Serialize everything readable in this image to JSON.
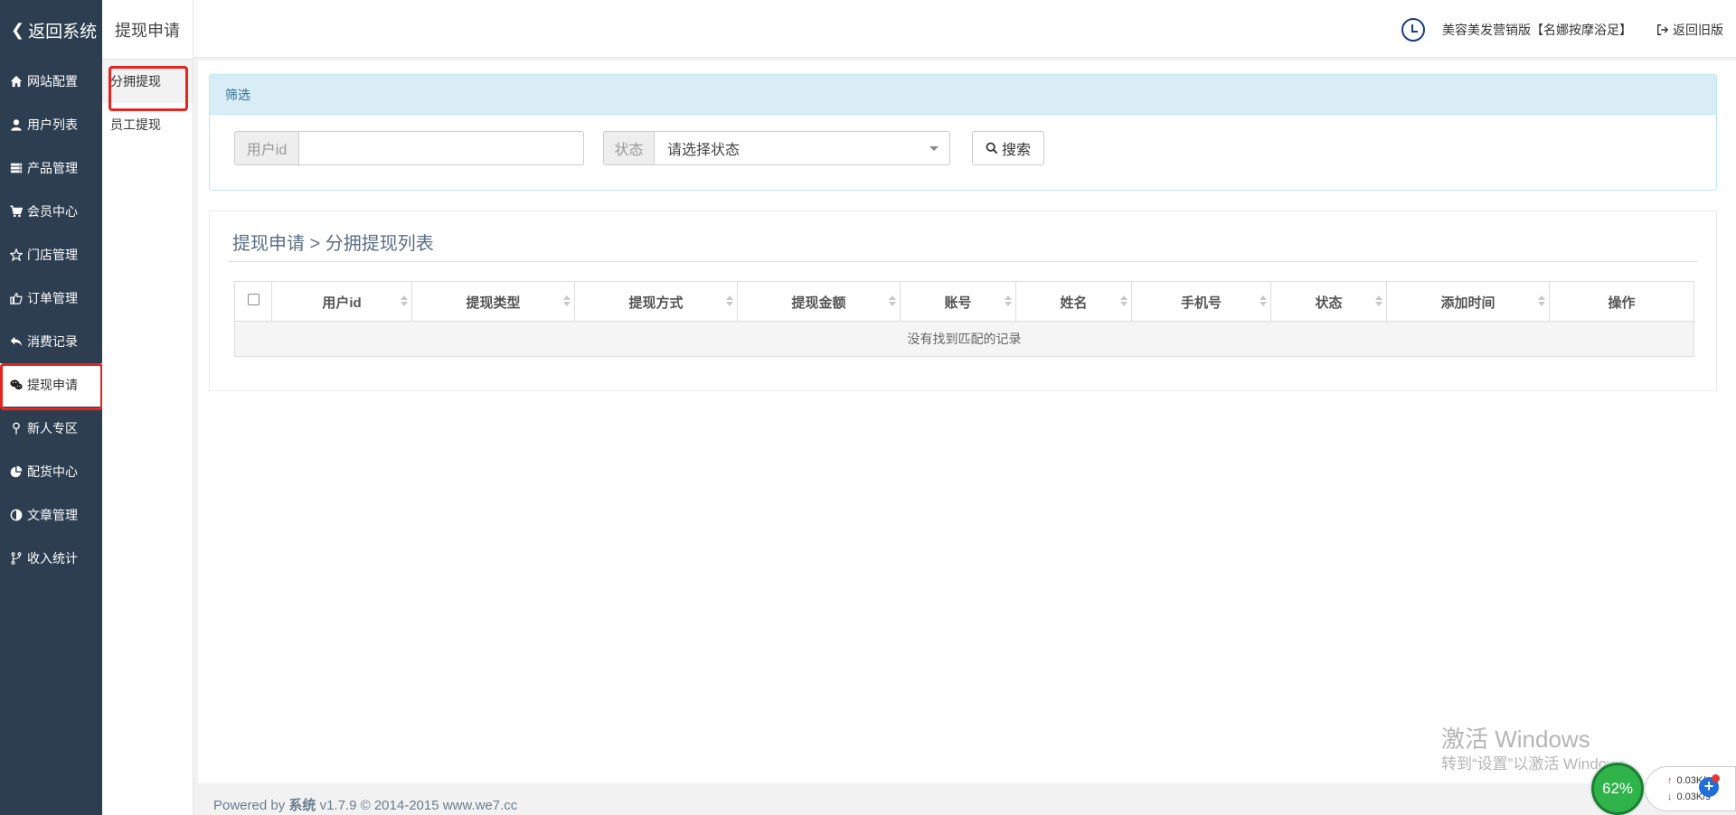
{
  "sidebar": {
    "back_label": "返回系统",
    "items": [
      {
        "label": "网站配置",
        "icon": "home-icon"
      },
      {
        "label": "用户列表",
        "icon": "user-icon"
      },
      {
        "label": "产品管理",
        "icon": "server-icon"
      },
      {
        "label": "会员中心",
        "icon": "cart-icon"
      },
      {
        "label": "门店管理",
        "icon": "star-icon"
      },
      {
        "label": "订单管理",
        "icon": "thumbs-up-icon"
      },
      {
        "label": "消费记录",
        "icon": "reply-icon"
      },
      {
        "label": "提现申请",
        "icon": "wechat-icon",
        "active": true
      },
      {
        "label": "新人专区",
        "icon": "map-pin-icon"
      },
      {
        "label": "配货中心",
        "icon": "pie-chart-icon"
      },
      {
        "label": "文章管理",
        "icon": "adjust-icon"
      },
      {
        "label": "收入统计",
        "icon": "code-fork-icon"
      }
    ]
  },
  "submenu": {
    "title": "提现申请",
    "items": [
      {
        "label": "分拥提现",
        "active": true
      },
      {
        "label": "员工提现"
      }
    ]
  },
  "header": {
    "brand": "美容美发营销版【名娜按摩浴足】",
    "back_old": "返回旧版"
  },
  "filter": {
    "heading": "筛选",
    "user_id_label": "用户id",
    "user_id_value": "",
    "status_label": "状态",
    "status_selected": "请选择状态",
    "search_label": "搜索"
  },
  "list": {
    "title": "提现申请 > 分拥提现列表",
    "columns": [
      "用户id",
      "提现类型",
      "提现方式",
      "提现金额",
      "账号",
      "姓名",
      "手机号",
      "状态",
      "添加时间",
      "操作"
    ],
    "empty_text": "没有找到匹配的记录"
  },
  "footer": {
    "prefix": "Powered by",
    "brand": "系统",
    "suffix": "v1.7.9 © 2014-2015 www.we7.cc"
  },
  "watermark": {
    "title": "激活 Windows",
    "subtitle": "转到“设置”以激活 Windows。"
  },
  "netmon": {
    "percent": "62%",
    "upload": "0.03K/s",
    "download": "0.03K/s"
  },
  "colors": {
    "sidebar_bg": "#2c3e50",
    "highlight_border": "#e8241e",
    "filter_head_bg": "#d9edf7",
    "gauge_green": "#2fb34a"
  }
}
